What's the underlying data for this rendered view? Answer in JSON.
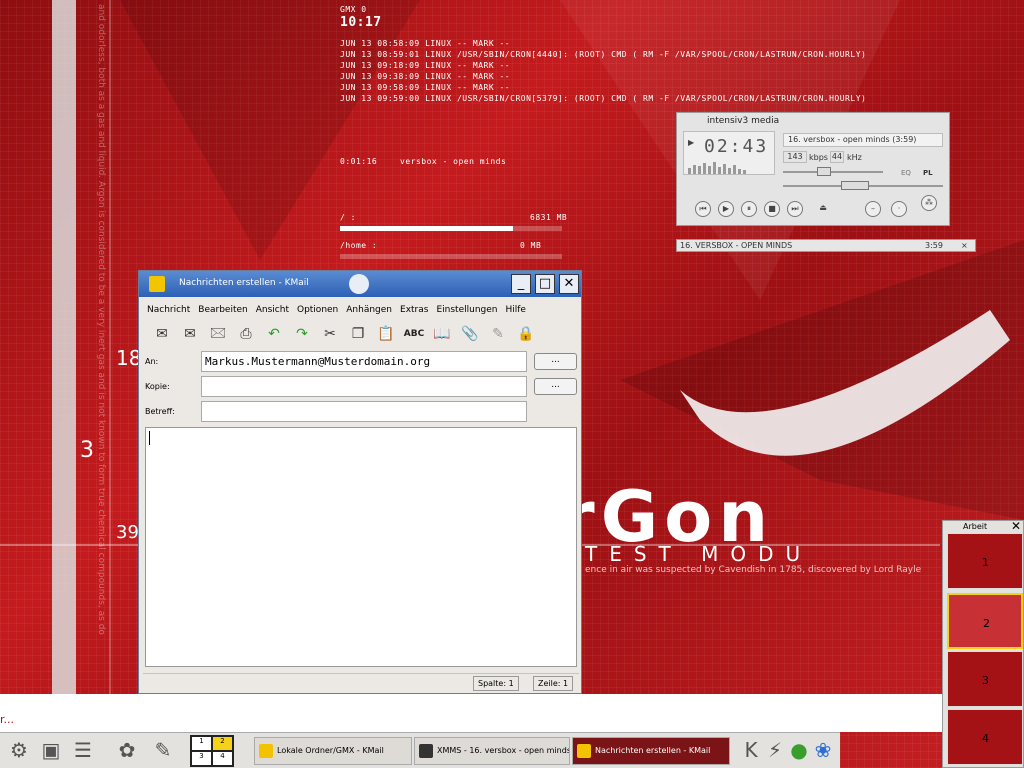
{
  "desktop": {
    "side_numbers": [
      "18",
      "3",
      "39"
    ],
    "side_text": "and odorless, both as a gas and liquid. Argon is considered to be a very inert gas and is not known to form true chemical compounds, as do",
    "big_text": "ArGon",
    "sub_text": "TEST MODU",
    "caption": "ence in air was suspected by Cavendish in 1785, discovered by Lord Rayle",
    "bottom_left": "r..."
  },
  "conky": {
    "host": "GMX 0",
    "clock": "10:17",
    "log": [
      "JUN 13 08:58:09 LINUX -- MARK --",
      "JUN 13 08:59:01 LINUX /USR/SBIN/CRON[4440]: (ROOT) CMD ( RM -F /VAR/SPOOL/CRON/LASTRUN/CRON.HOURLY)",
      "JUN 13 09:18:09 LINUX -- MARK --",
      "JUN 13 09:38:09 LINUX -- MARK --",
      "JUN 13 09:58:09 LINUX -- MARK --",
      " JUN 13 09:59:00 LINUX /USR/SBIN/CRON[5379]: (ROOT) CMD ( RM -F /VAR/SPOOL/CRON/LASTRUN/CRON.HOURLY)"
    ],
    "track_time": "0:01:16",
    "track": "versbox - open minds",
    "disks": [
      {
        "mount": "/ :",
        "size": "6831 MB",
        "fill": 0.78
      },
      {
        "mount": "/home :",
        "size": "0 MB",
        "fill": 0.0
      }
    ]
  },
  "xmms": {
    "brand": "intensiv3 media",
    "time": "02:43",
    "title": "16. versbox - open minds (3:59)",
    "kbps": "143",
    "kbps_label": "kbps",
    "khz": "44",
    "khz_label": "kHz",
    "eq_label": "EQ",
    "pl_label": "PL",
    "playlist_entry": "16. VERSBOX - OPEN MINDS",
    "playlist_time": "3:59",
    "buttons": [
      "prev",
      "play",
      "pause",
      "stop",
      "next",
      "eject"
    ]
  },
  "kmail": {
    "title": "Nachrichten erstellen - KMail",
    "menu": [
      "Nachricht",
      "Bearbeiten",
      "Ansicht",
      "Optionen",
      "Anhängen",
      "Extras",
      "Einstellungen",
      "Hilfe"
    ],
    "fields": {
      "to_label": "An:",
      "to_value": "Markus.Mustermann@Musterdomain.org",
      "cc_label": "Kopie:",
      "cc_value": "",
      "subject_label": "Betreff:",
      "subject_value": ""
    },
    "dots_label": "...",
    "body": "",
    "status_col": "Spalte: 1",
    "status_row": "Zeile: 1"
  },
  "taskbar": {
    "tasks": [
      {
        "label": "Lokale Ordner/GMX - KMail",
        "active": false
      },
      {
        "label": "XMMS - 16. versbox - open minds",
        "active": false
      },
      {
        "label": "Nachrichten erstellen - KMail",
        "active": true
      }
    ],
    "desktops": [
      "1",
      "2",
      "3",
      "4"
    ]
  },
  "pager": {
    "title": "Arbeit",
    "desktops": [
      "1",
      "2",
      "3",
      "4"
    ]
  }
}
